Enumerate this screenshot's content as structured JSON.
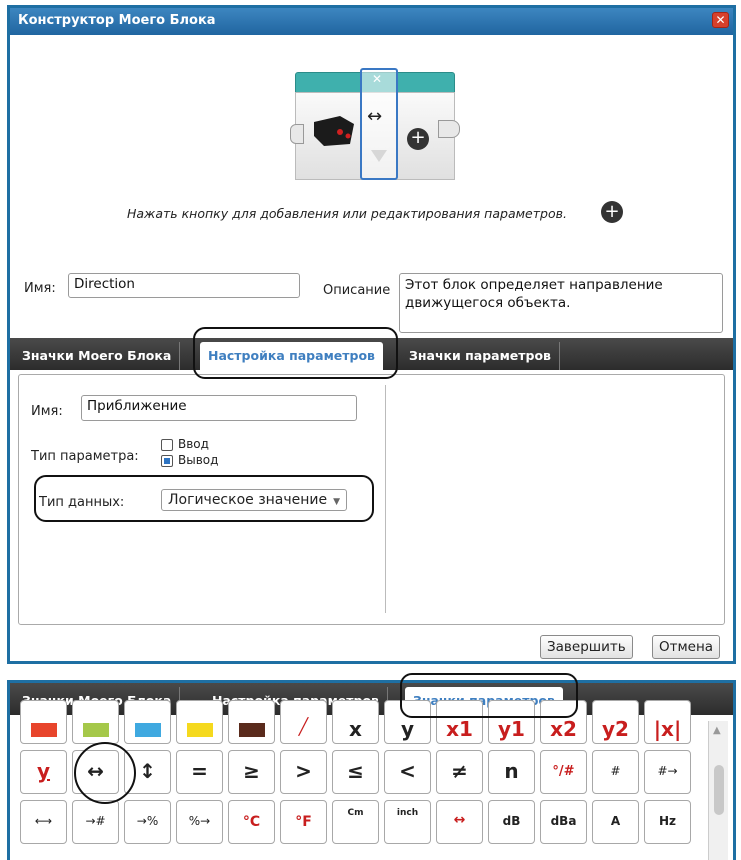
{
  "dialog": {
    "title": "Конструктор Моего Блока",
    "close_glyph": "✕",
    "block_preview": {
      "param_close": "✕",
      "param_arrow": "↔",
      "add": "+"
    },
    "hint": "Нажать кнопку для добавления или редактирования параметров.",
    "hint_plus": "+",
    "name_label": "Имя:",
    "name_value": "Direction",
    "description_label": "Описание",
    "description_value": "Этот блок определяет направление движущегося объекта.",
    "tabs": [
      "Значки Моего Блока",
      "Настройка параметров",
      "Значки параметров"
    ],
    "active_tab": 1,
    "param": {
      "name_label": "Имя:",
      "name_value": "Приближение",
      "type_label": "Тип параметра:",
      "type_options": [
        {
          "label": "Ввод",
          "checked": false
        },
        {
          "label": "Вывод",
          "checked": true
        }
      ],
      "data_type_label": "Тип данных:",
      "data_type_value": "Логическое значение"
    },
    "finish_button": "Завершить",
    "cancel_button": "Отмена"
  },
  "icons_panel": {
    "tabs": [
      "Значки Моего Блока",
      "Настройка параметров",
      "Значки параметров"
    ],
    "active_tab": 2,
    "rows": [
      [
        {
          "icon": "red-swatch-icon",
          "color": "#e8452c"
        },
        {
          "icon": "green-swatch-icon",
          "color": "#a5c84a"
        },
        {
          "icon": "blue-swatch-icon",
          "color": "#3fa9e0"
        },
        {
          "icon": "yellow-swatch-icon",
          "color": "#f5d91e"
        },
        {
          "icon": "brown-swatch-icon",
          "color": "#5a2b1c"
        },
        {
          "icon": "slash-box-icon",
          "glyph": "╱"
        },
        {
          "icon": "x-icon",
          "glyph": "x"
        },
        {
          "icon": "y-icon",
          "glyph": "y"
        },
        {
          "icon": "x1-icon",
          "glyph": "x1"
        },
        {
          "icon": "y1-icon",
          "glyph": "y1"
        },
        {
          "icon": "x2-icon",
          "glyph": "x2"
        },
        {
          "icon": "y2-icon",
          "glyph": "y2"
        },
        {
          "icon": "abs-x-icon",
          "glyph": "|x|"
        }
      ],
      [
        {
          "icon": "y-underline-icon",
          "glyph": "y"
        },
        {
          "icon": "horizontal-arrow-icon",
          "glyph": "↔"
        },
        {
          "icon": "vertical-arrow-icon",
          "glyph": "↕"
        },
        {
          "icon": "equals-icon",
          "glyph": "="
        },
        {
          "icon": "greater-equal-icon",
          "glyph": "≥"
        },
        {
          "icon": "greater-than-icon",
          "glyph": ">"
        },
        {
          "icon": "less-equal-icon",
          "glyph": "≤"
        },
        {
          "icon": "less-than-icon",
          "glyph": "<"
        },
        {
          "icon": "not-equal-icon",
          "glyph": "≠"
        },
        {
          "icon": "n-icon",
          "glyph": "n"
        },
        {
          "icon": "degree-hash-icon",
          "glyph": "°/#"
        },
        {
          "icon": "hash-down-icon",
          "glyph": "#"
        },
        {
          "icon": "hash-out-icon",
          "glyph": "#→"
        }
      ],
      [
        {
          "icon": "width-icon",
          "glyph": "⟷"
        },
        {
          "icon": "hash-in-icon",
          "glyph": "→#"
        },
        {
          "icon": "percent-in-icon",
          "glyph": "→%"
        },
        {
          "icon": "percent-out-icon",
          "glyph": "%→"
        },
        {
          "icon": "celsius-icon",
          "glyph": "°C"
        },
        {
          "icon": "fahrenheit-icon",
          "glyph": "°F"
        },
        {
          "icon": "cm-icon",
          "glyph": "Cm"
        },
        {
          "icon": "inch-icon",
          "glyph": "inch"
        },
        {
          "icon": "span-icon",
          "glyph": "↔"
        },
        {
          "icon": "db-icon",
          "glyph": "dB"
        },
        {
          "icon": "dba-icon",
          "glyph": "dBa"
        },
        {
          "icon": "a-icon",
          "glyph": "A"
        },
        {
          "icon": "hz-icon",
          "glyph": "Hz"
        }
      ]
    ]
  }
}
